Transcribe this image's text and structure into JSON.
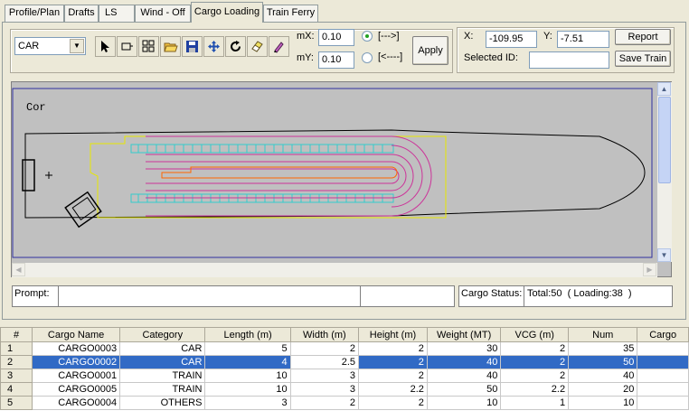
{
  "tabs": [
    {
      "label": "Profile/Plan"
    },
    {
      "label": "Drafts"
    },
    {
      "label": "LS"
    },
    {
      "label": "Wind - Off"
    },
    {
      "label": "Cargo Loading"
    },
    {
      "label": "Train Ferry"
    }
  ],
  "active_tab": "Cargo Loading",
  "toolbar": {
    "category_select": "CAR",
    "tools": [
      "pointer-icon",
      "add-cargo-icon",
      "grid-icon",
      "open-folder-icon",
      "save-icon",
      "move-icon",
      "rotate-icon",
      "eraser-icon",
      "pen-icon"
    ]
  },
  "move": {
    "mx_label": "mX:",
    "mx_value": "0.10",
    "my_label": "mY:",
    "my_value": "0.10",
    "forward_label": "[--->]",
    "backward_label": "[<----]",
    "apply_label": "Apply"
  },
  "coords": {
    "x_label": "X:",
    "x_value": "-109.95",
    "y_label": "Y:",
    "y_value": "-7.51",
    "selected_id_label": "Selected ID:",
    "selected_id_value": "",
    "report_label": "Report",
    "save_train_label": "Save Train"
  },
  "canvas": {
    "corner_label": "Cor"
  },
  "status": {
    "prompt_label": "Prompt:",
    "prompt_value": "",
    "cargo_status_label": "Cargo Status:",
    "cargo_status_value": "Total:50  ( Loading:38  )"
  },
  "colors": {
    "canvas_bg": "#c0c0c0",
    "hull": "#000000",
    "deck_outline": "#ffff00",
    "lane_blue": "#33cccc",
    "lane_magenta": "#cc3399",
    "lane_orange": "#ff6600",
    "selection": "#316ac5"
  },
  "table": {
    "columns": [
      "#",
      "Cargo Name",
      "Category",
      "Length (m)",
      "Width (m)",
      "Height (m)",
      "Weight (MT)",
      "VCG (m)",
      "Num",
      "Cargo"
    ],
    "rows": [
      {
        "idx": "1",
        "name": "CARGO0003",
        "category": "CAR",
        "length": "5",
        "width": "2",
        "height": "2",
        "weight": "30",
        "vcg": "2",
        "num": "35",
        "extra": ""
      },
      {
        "idx": "2",
        "name": "CARGO0002",
        "category": "CAR",
        "length": "4",
        "width": "2.5",
        "height": "2",
        "weight": "40",
        "vcg": "2",
        "num": "50",
        "extra": ""
      },
      {
        "idx": "3",
        "name": "CARGO0001",
        "category": "TRAIN",
        "length": "10",
        "width": "3",
        "height": "2",
        "weight": "40",
        "vcg": "2",
        "num": "40",
        "extra": ""
      },
      {
        "idx": "4",
        "name": "CARGO0005",
        "category": "TRAIN",
        "length": "10",
        "width": "3",
        "height": "2.2",
        "weight": "50",
        "vcg": "2.2",
        "num": "20",
        "extra": ""
      },
      {
        "idx": "5",
        "name": "CARGO0004",
        "category": "OTHERS",
        "length": "3",
        "width": "2",
        "height": "2",
        "weight": "10",
        "vcg": "1",
        "num": "10",
        "extra": ""
      }
    ],
    "selected_row": 1
  }
}
